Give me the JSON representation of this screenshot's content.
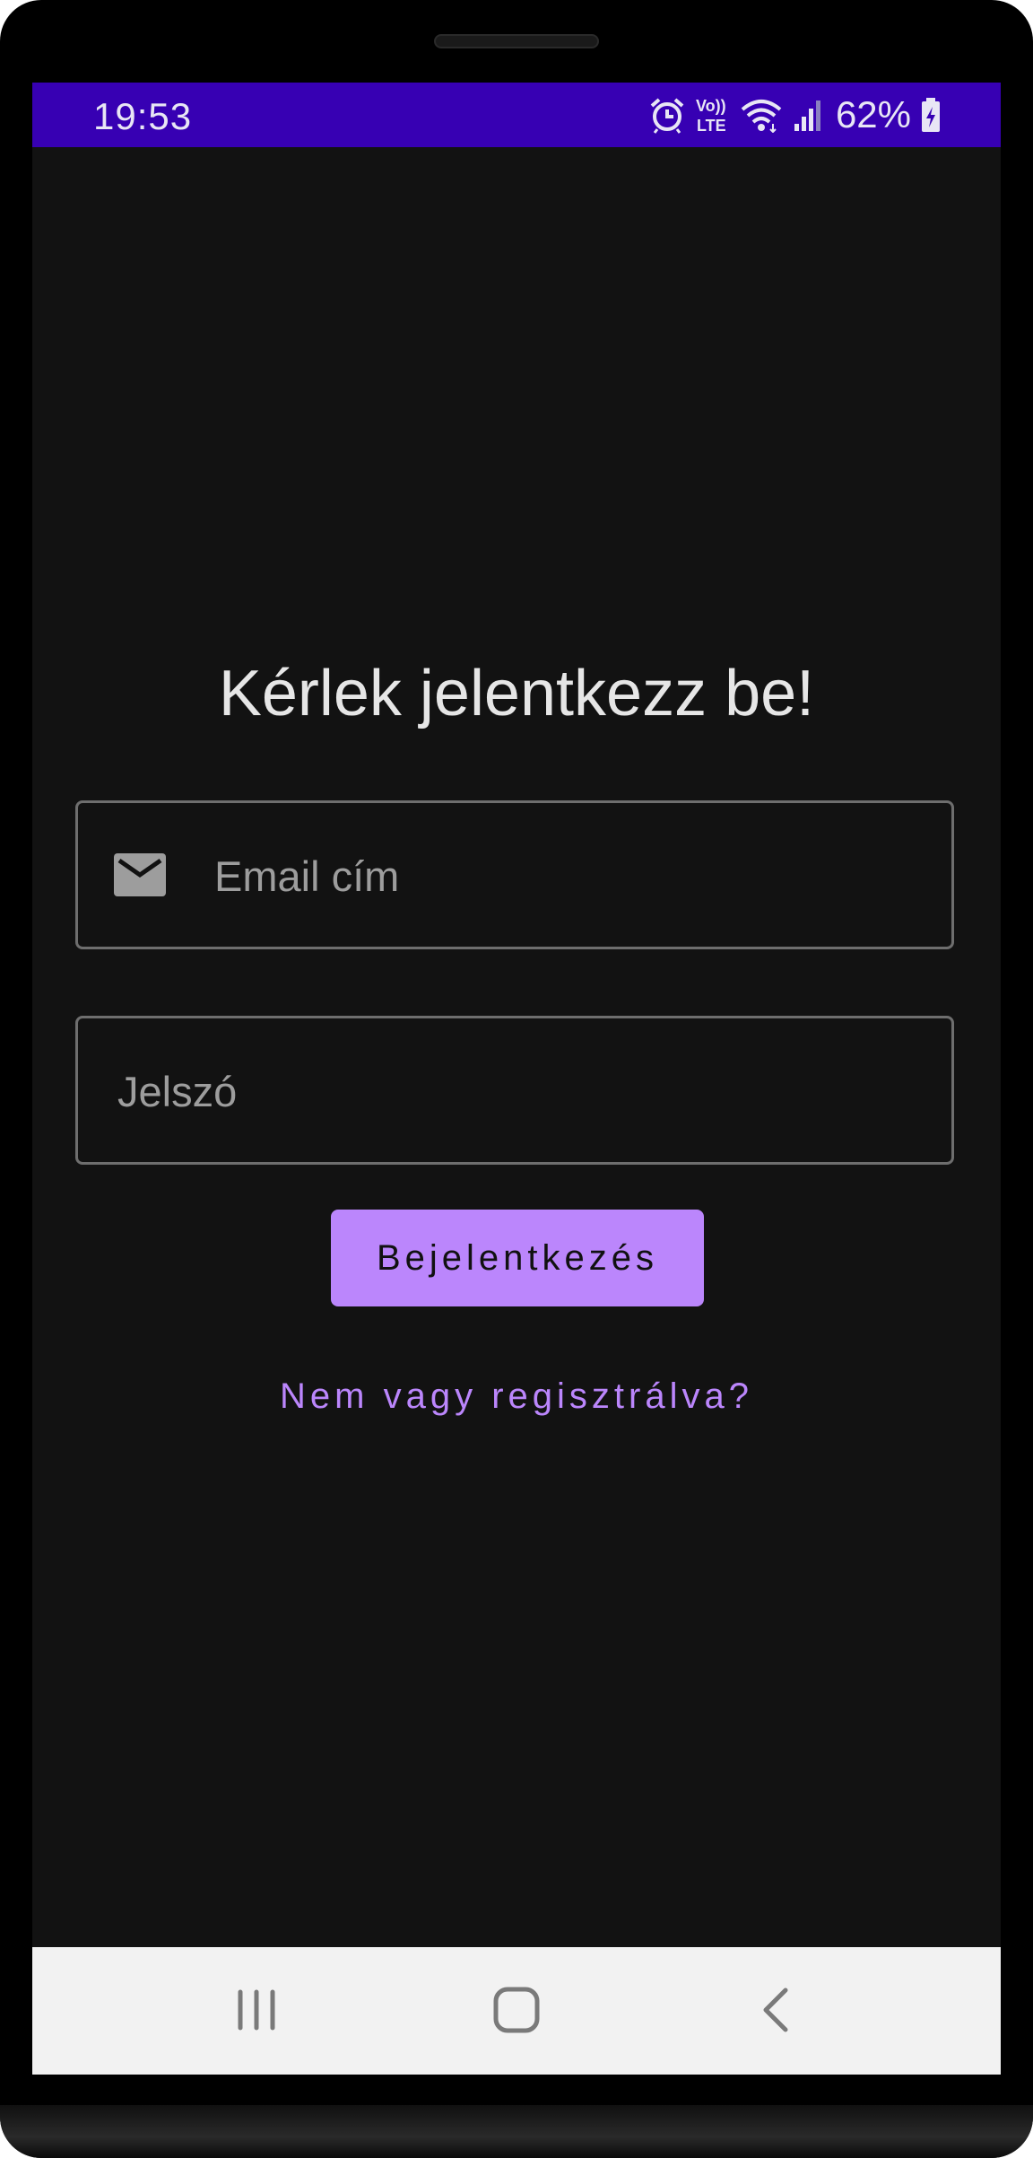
{
  "status_bar": {
    "time": "19:53",
    "icons": [
      "alarm-icon",
      "volte-icon",
      "wifi-icon",
      "signal-icon",
      "battery-charging-icon"
    ],
    "volte_label_top": "Vo))",
    "volte_label_bottom": "LTE",
    "battery_percent": "62%",
    "background_color": "#3700b3"
  },
  "login": {
    "title": "Kérlek jelentkezz be!",
    "email_field": {
      "placeholder": "Email cím",
      "value": "",
      "icon": "mail-icon"
    },
    "password_field": {
      "placeholder": "Jelszó",
      "value": ""
    },
    "login_button_label": "Bejelentkezés",
    "register_link_label": "Nem vagy regisztrálva?",
    "accent_color": "#bb86fc",
    "background_color": "#121212"
  },
  "nav_bar": {
    "buttons": [
      "recents-icon",
      "home-icon",
      "back-icon"
    ]
  }
}
